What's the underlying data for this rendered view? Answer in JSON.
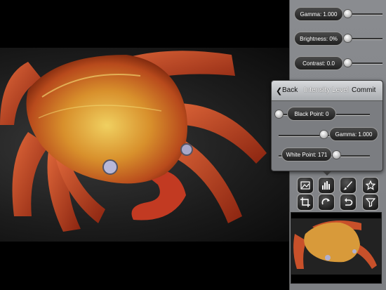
{
  "sliders": {
    "gamma_label": "Gamma: 1.000",
    "brightness_label": "Brightness:  0%",
    "contrast_label": "Contrast: 0.0"
  },
  "intensity_popover": {
    "back_label": "Back",
    "title": "Intensity Level",
    "commit_label": "Commit",
    "black_point_label": "Black Point: 0",
    "gamma_label": "Gamma: 1.000",
    "white_point_label": "White Point: 171"
  },
  "tools": [
    {
      "icon": "image-icon"
    },
    {
      "icon": "histogram-icon"
    },
    {
      "icon": "brush-icon"
    },
    {
      "icon": "star-icon"
    },
    {
      "icon": "crop-icon"
    },
    {
      "icon": "rotate-right-icon"
    },
    {
      "icon": "undo-icon"
    },
    {
      "icon": "filter-icon"
    }
  ],
  "colors": {
    "panel_bg": "#888a8e",
    "pill_bg": "#2e2e2e",
    "accent_orange": "#d8602a"
  }
}
